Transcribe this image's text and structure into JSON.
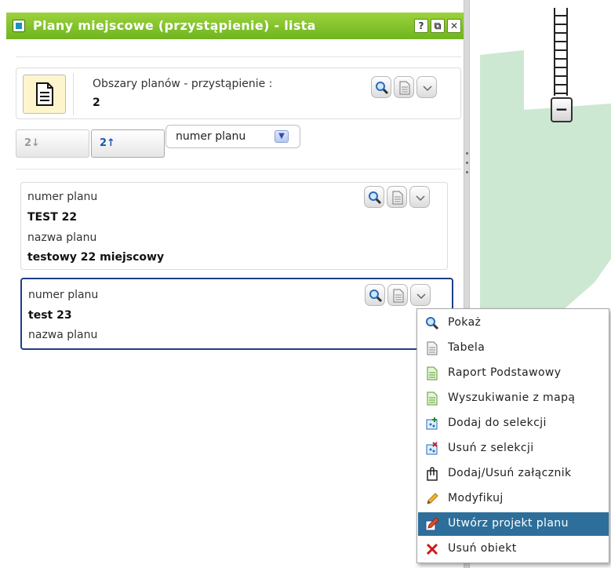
{
  "window": {
    "title": "Plany miejscowe (przystąpienie) - lista",
    "help_glyph": "?",
    "restore_glyph": "⧉",
    "close_glyph": "✕"
  },
  "summary": {
    "label": "Obszary planów - przystąpienie :",
    "count": "2"
  },
  "sort": {
    "ascending_icon_text": "2↓",
    "descending_icon_text": "2↑",
    "field_selected": "numer planu",
    "dropdown_glyph": "▼"
  },
  "records": [
    {
      "field1_label": "numer planu",
      "field1_value": "TEST 22",
      "field2_label": "nazwa planu",
      "field2_value": "testowy 22 miejscowy"
    },
    {
      "field1_label": "numer planu",
      "field1_value": "test 23",
      "field2_label": "nazwa planu"
    }
  ],
  "context_menu": {
    "items": [
      {
        "label": "Pokaż",
        "icon": "magnifier-icon"
      },
      {
        "label": "Tabela",
        "icon": "document-icon"
      },
      {
        "label": "Raport Podstawowy",
        "icon": "report-icon"
      },
      {
        "label": "Wyszukiwanie z mapą",
        "icon": "map-search-icon"
      },
      {
        "label": "Dodaj do selekcji",
        "icon": "add-selection-icon"
      },
      {
        "label": "Usuń z selekcji",
        "icon": "remove-selection-icon"
      },
      {
        "label": "Dodaj/Usuń załącznik",
        "icon": "attachment-icon"
      },
      {
        "label": "Modyfikuj",
        "icon": "pencil-icon"
      },
      {
        "label": "Utwórz projekt planu",
        "icon": "create-project-icon",
        "active": true
      },
      {
        "label": "Usuń obiekt",
        "icon": "delete-x-icon"
      }
    ]
  },
  "map": {
    "zoom_out_glyph": "−",
    "area_color": "#cde8d2"
  },
  "colors": {
    "title_bar": "#7cc02a",
    "menu_highlight": "#2d6f9a",
    "selected_border": "#1e3f86"
  }
}
